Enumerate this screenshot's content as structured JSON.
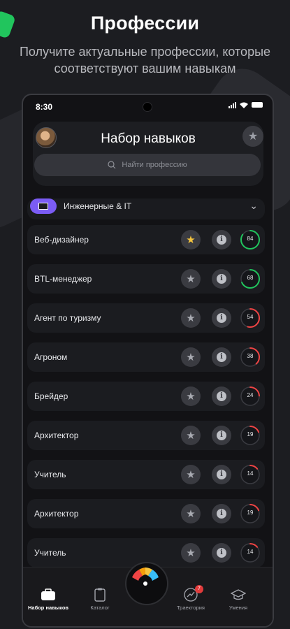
{
  "promo": {
    "title": "Профессии",
    "subtitle": "Получите актуальные профессии, которые соответствуют вашим навыкам"
  },
  "status_bar": {
    "time": "8:30"
  },
  "header": {
    "title": "Набор навыков",
    "search_placeholder": "Найти профессию"
  },
  "category": {
    "label": "Инженерные & IT"
  },
  "professions": [
    {
      "name": "Веб-дизайнер",
      "score": 84,
      "favorite": true,
      "ring_color": "#21c55d"
    },
    {
      "name": "BTL-менеджер",
      "score": 68,
      "favorite": false,
      "ring_color": "#21c55d"
    },
    {
      "name": "Агент по туризму",
      "score": 54,
      "favorite": false,
      "ring_color": "#ef4444"
    },
    {
      "name": "Агроном",
      "score": 38,
      "favorite": false,
      "ring_color": "#ef4444"
    },
    {
      "name": "Брейдер",
      "score": 24,
      "favorite": false,
      "ring_color": "#ef4444"
    },
    {
      "name": "Архитектор",
      "score": 19,
      "favorite": false,
      "ring_color": "#ef4444"
    },
    {
      "name": "Учитель",
      "score": 14,
      "favorite": false,
      "ring_color": "#ef4444"
    },
    {
      "name": "Архитектор",
      "score": 19,
      "favorite": false,
      "ring_color": "#ef4444"
    },
    {
      "name": "Учитель",
      "score": 14,
      "favorite": false,
      "ring_color": "#ef4444"
    }
  ],
  "nav": {
    "skills": "Набор навыков",
    "catalog": "Каталог",
    "trajectory": "Траектория",
    "trajectory_badge": "7",
    "abilities": "Умения"
  },
  "icons": {
    "favorite": "star-icon",
    "info": "info-icon",
    "search": "search-icon",
    "category": "monitor-icon",
    "expand": "chevron-down-icon"
  }
}
